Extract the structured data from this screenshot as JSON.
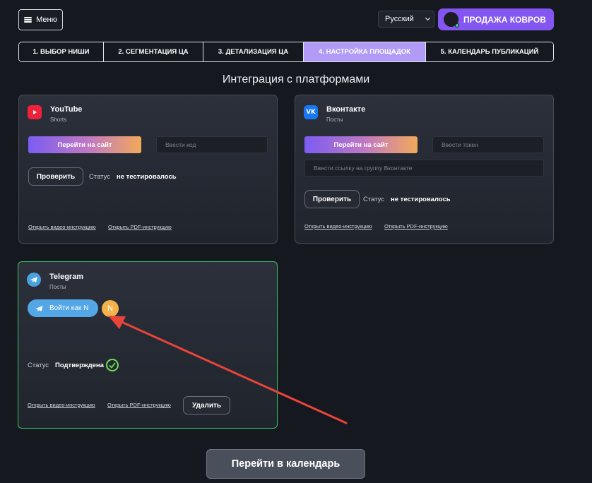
{
  "header": {
    "menu_label": "Меню",
    "language": "Русский",
    "company_name": "ПРОДАЖА КОВРОВ"
  },
  "steps": [
    {
      "label": "1. Выбор ниши"
    },
    {
      "label": "2. Сегментация ЦА"
    },
    {
      "label": "3. Детализация ЦА"
    },
    {
      "label": "4. Настройка площадок",
      "active": true
    },
    {
      "label": "5. Календарь публикаций"
    }
  ],
  "page_title": "Интеграция с платформами",
  "youtube": {
    "name": "YouTube",
    "subtitle": "Shorts",
    "go_site_label": "Перейти на сайт",
    "code_placeholder": "Ввести код",
    "check_label": "Проверить",
    "status_label": "Статус",
    "status_value": "не тестировалось",
    "video_link": "Открыть видео-инструкцию",
    "pdf_link": "Открыть PDF-инструкцию"
  },
  "vk": {
    "name": "Вконтакте",
    "subtitle": "Посты",
    "go_site_label": "Перейти на сайт",
    "token_placeholder": "Ввести токен",
    "group_placeholder": "Ввести ссылку на группу Вконтакте",
    "check_label": "Проверить",
    "status_label": "Статус",
    "status_value": "не тестировалось",
    "video_link": "Открыть видео-инструкцию",
    "pdf_link": "Открыть PDF-инструкцию"
  },
  "telegram": {
    "name": "Telegram",
    "subtitle": "Посты",
    "login_label": "Войти как N",
    "avatar_initial": "N",
    "status_label": "Статус",
    "status_value": "Подтверждена",
    "video_link": "Открыть видео-инструкцию",
    "pdf_link": "Открыть PDF-инструкцию",
    "delete_label": "Удалить"
  },
  "calendar_button": "Перейти в календарь",
  "colors": {
    "accent": "#8356f2",
    "active_step": "#b29bf7",
    "confirmed": "#37c16a",
    "annotation_arrow": "#e8443a"
  }
}
